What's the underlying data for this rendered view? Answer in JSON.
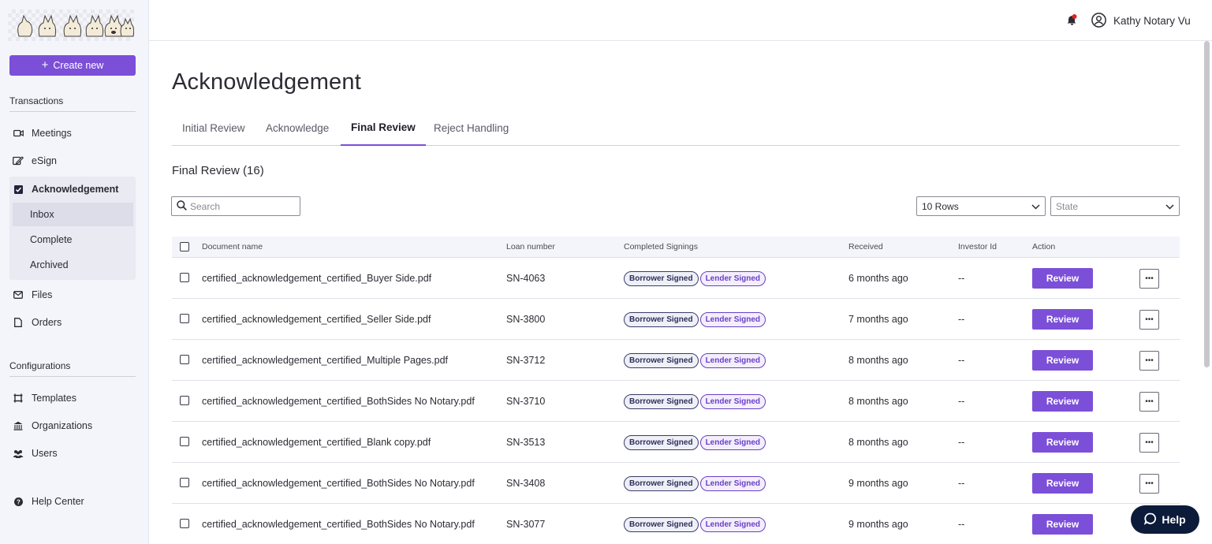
{
  "sidebar": {
    "create_label": "Create new",
    "transactions_title": "Transactions",
    "items": {
      "meetings": "Meetings",
      "esign": "eSign",
      "acknowledgement": "Acknowledgement",
      "inbox": "Inbox",
      "complete": "Complete",
      "archived": "Archived",
      "files": "Files",
      "orders": "Orders"
    },
    "configurations_title": "Configurations",
    "config_items": {
      "templates": "Templates",
      "organizations": "Organizations",
      "users": "Users"
    },
    "help_center": "Help Center"
  },
  "header": {
    "user_name": "Kathy Notary Vu"
  },
  "main": {
    "title": "Acknowledgement",
    "tabs": [
      "Initial Review",
      "Acknowledge",
      "Final Review",
      "Reject Handling"
    ],
    "list_title": "Final Review (16)",
    "search_placeholder": "Search",
    "rows_select": "10 Rows",
    "state_placeholder": "State"
  },
  "table": {
    "columns": [
      "Document name",
      "Loan number",
      "Completed Signings",
      "Received",
      "Investor Id",
      "Action"
    ],
    "rows": [
      {
        "doc": "certified_acknowledgement_certified_Buyer Side.pdf",
        "loan": "SN-4063",
        "badges": [
          "Borrower Signed",
          "Lender Signed"
        ],
        "received": "6 months ago",
        "investor": "--",
        "action": "Review"
      },
      {
        "doc": "certified_acknowledgement_certified_Seller Side.pdf",
        "loan": "SN-3800",
        "badges": [
          "Borrower Signed",
          "Lender Signed"
        ],
        "received": "7 months ago",
        "investor": "--",
        "action": "Review"
      },
      {
        "doc": "certified_acknowledgement_certified_Multiple Pages.pdf",
        "loan": "SN-3712",
        "badges": [
          "Borrower Signed",
          "Lender Signed"
        ],
        "received": "8 months ago",
        "investor": "--",
        "action": "Review"
      },
      {
        "doc": "certified_acknowledgement_certified_BothSides No Notary.pdf",
        "loan": "SN-3710",
        "badges": [
          "Borrower Signed",
          "Lender Signed"
        ],
        "received": "8 months ago",
        "investor": "--",
        "action": "Review"
      },
      {
        "doc": "certified_acknowledgement_certified_Blank copy.pdf",
        "loan": "SN-3513",
        "badges": [
          "Borrower Signed",
          "Lender Signed"
        ],
        "received": "8 months ago",
        "investor": "--",
        "action": "Review"
      },
      {
        "doc": "certified_acknowledgement_certified_BothSides No Notary.pdf",
        "loan": "SN-3408",
        "badges": [
          "Borrower Signed",
          "Lender Signed"
        ],
        "received": "9 months ago",
        "investor": "--",
        "action": "Review"
      },
      {
        "doc": "certified_acknowledgement_certified_BothSides No Notary.pdf",
        "loan": "SN-3077",
        "badges": [
          "Borrower Signed",
          "Lender Signed"
        ],
        "received": "9 months ago",
        "investor": "--",
        "action": "Review"
      }
    ]
  },
  "help_label": "Help",
  "colors": {
    "accent": "#7c4fd8",
    "help_bg": "#0d1b3a",
    "notification_dot": "#e02424"
  }
}
